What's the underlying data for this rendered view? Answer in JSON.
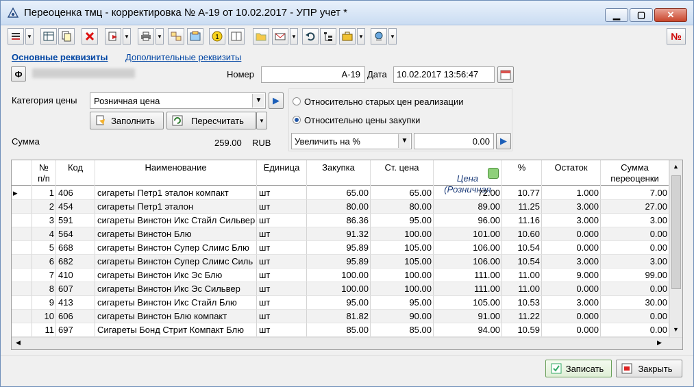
{
  "window": {
    "title": "Переоценка тмц - корректировка № А-19 от 10.02.2017 - УПР учет *",
    "btn_minimize": "▁",
    "btn_maximize": "▢",
    "btn_close": "✕"
  },
  "toolbar": {
    "items": [
      "list-icon",
      "table-icon",
      "copy-icon",
      "delete-icon",
      "move-icon",
      "print-icon",
      "structure-icon",
      "edit-icon",
      "coin-icon",
      "book-icon",
      "folder-icon",
      "mail-icon",
      "undo-icon",
      "tree-icon",
      "briefcase-icon",
      "network-icon"
    ],
    "number_glyph": "№"
  },
  "tabs": {
    "main": "Основные реквизиты",
    "extra": "Дополнительные реквизиты"
  },
  "header": {
    "org_button": "Ф",
    "number_label": "Номер",
    "number_value": "А-19",
    "date_label": "Дата",
    "date_value": "10.02.2017 13:56:47"
  },
  "price": {
    "category_label": "Категория цены",
    "category_value": "Розничная цена",
    "fill_button": "Заполнить",
    "recalc_button": "Пересчитать",
    "sum_label": "Сумма",
    "sum_value": "259.00",
    "currency": "RUB"
  },
  "options": {
    "radio_old": "Относительно старых цен реализации",
    "radio_purchase": "Относительно цены закупки",
    "mode_value": "Увеличить на %",
    "percent_value": "0.00"
  },
  "table": {
    "columns": [
      "№\nп/п",
      "Код",
      "Наименование",
      "Единица",
      "Закупка",
      "Ст. цена",
      "Цена\n(Розничная",
      "%",
      "Остаток",
      "Сумма\nпереоценки"
    ],
    "rows": [
      [
        "1",
        "406",
        "сигареты Петр1 эталон компакт",
        "шт",
        "65.00",
        "65.00",
        "72.00",
        "10.77",
        "1.000",
        "7.00"
      ],
      [
        "2",
        "454",
        "сигареты Петр1 эталон",
        "шт",
        "80.00",
        "80.00",
        "89.00",
        "11.25",
        "3.000",
        "27.00"
      ],
      [
        "3",
        "591",
        "сигареты Винстон Икс Стайл Сильвер",
        "шт",
        "86.36",
        "95.00",
        "96.00",
        "11.16",
        "3.000",
        "3.00"
      ],
      [
        "4",
        "564",
        "сигареты Винстон Блю",
        "шт",
        "91.32",
        "100.00",
        "101.00",
        "10.60",
        "0.000",
        "0.00"
      ],
      [
        "5",
        "668",
        "сигареты Винстон Супер Слимс Блю",
        "шт",
        "95.89",
        "105.00",
        "106.00",
        "10.54",
        "0.000",
        "0.00"
      ],
      [
        "6",
        "682",
        "сигареты Винстон Супер Слимс Силь",
        "шт",
        "95.89",
        "105.00",
        "106.00",
        "10.54",
        "3.000",
        "3.00"
      ],
      [
        "7",
        "410",
        "сигареты Винстон Икс Эс Блю",
        "шт",
        "100.00",
        "100.00",
        "111.00",
        "11.00",
        "9.000",
        "99.00"
      ],
      [
        "8",
        "607",
        "сигареты Винстон Икс Эс Сильвер",
        "шт",
        "100.00",
        "100.00",
        "111.00",
        "11.00",
        "0.000",
        "0.00"
      ],
      [
        "9",
        "413",
        "сигареты Винстон Икс Стайл Блю",
        "шт",
        "95.00",
        "95.00",
        "105.00",
        "10.53",
        "3.000",
        "30.00"
      ],
      [
        "10",
        "606",
        "сигареты Винстон Блю компакт",
        "шт",
        "81.82",
        "90.00",
        "91.00",
        "11.22",
        "0.000",
        "0.00"
      ],
      [
        "11",
        "697",
        "Сигареты Бонд Стрит Компакт Блю",
        "шт",
        "85.00",
        "85.00",
        "94.00",
        "10.59",
        "0.000",
        "0.00"
      ]
    ]
  },
  "footer": {
    "save_button": "Записать",
    "close_button": "Закрыть"
  },
  "colors": {
    "link": "#0045a3",
    "title_bar": "#cadcf2",
    "close_button": "#c9462c"
  }
}
